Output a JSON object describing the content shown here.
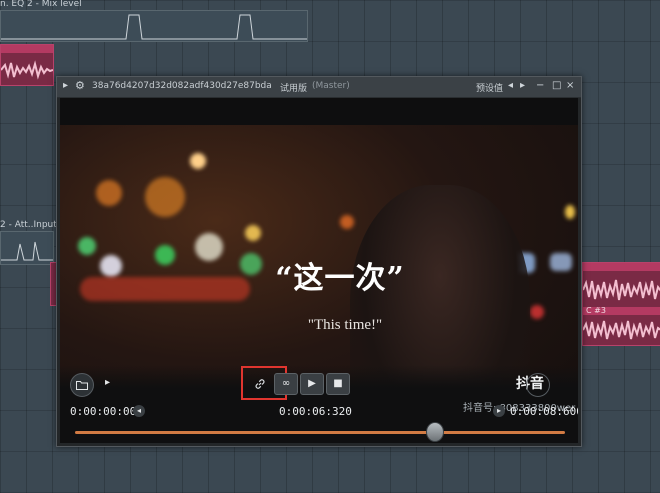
{
  "playlist": {
    "track_eq_label": "n. EQ 2 - Mix level",
    "track_att_label": "2 - Att..Input",
    "clip_label": "C #3"
  },
  "plugin": {
    "title": "38a76d4207d32d082adf430d27e87bda",
    "trial_label": "试用版",
    "master_label": "(Master)",
    "preset_label": "预设值",
    "minimize": "−",
    "maximize": "□",
    "close": "×"
  },
  "video": {
    "subtitle_cn": "“这一次”",
    "subtitle_en": "\"This time!\"",
    "watermark_id": "抖音号: 808333800wer",
    "watermark_brand": "抖音"
  },
  "player": {
    "time_start": "0:00:00:000",
    "time_current": "0:00:06:320",
    "time_end": "0:00:08:600",
    "progress": 0.735
  },
  "colors": {
    "highlight": "#e0352f",
    "seek_track": "#d27b43"
  }
}
